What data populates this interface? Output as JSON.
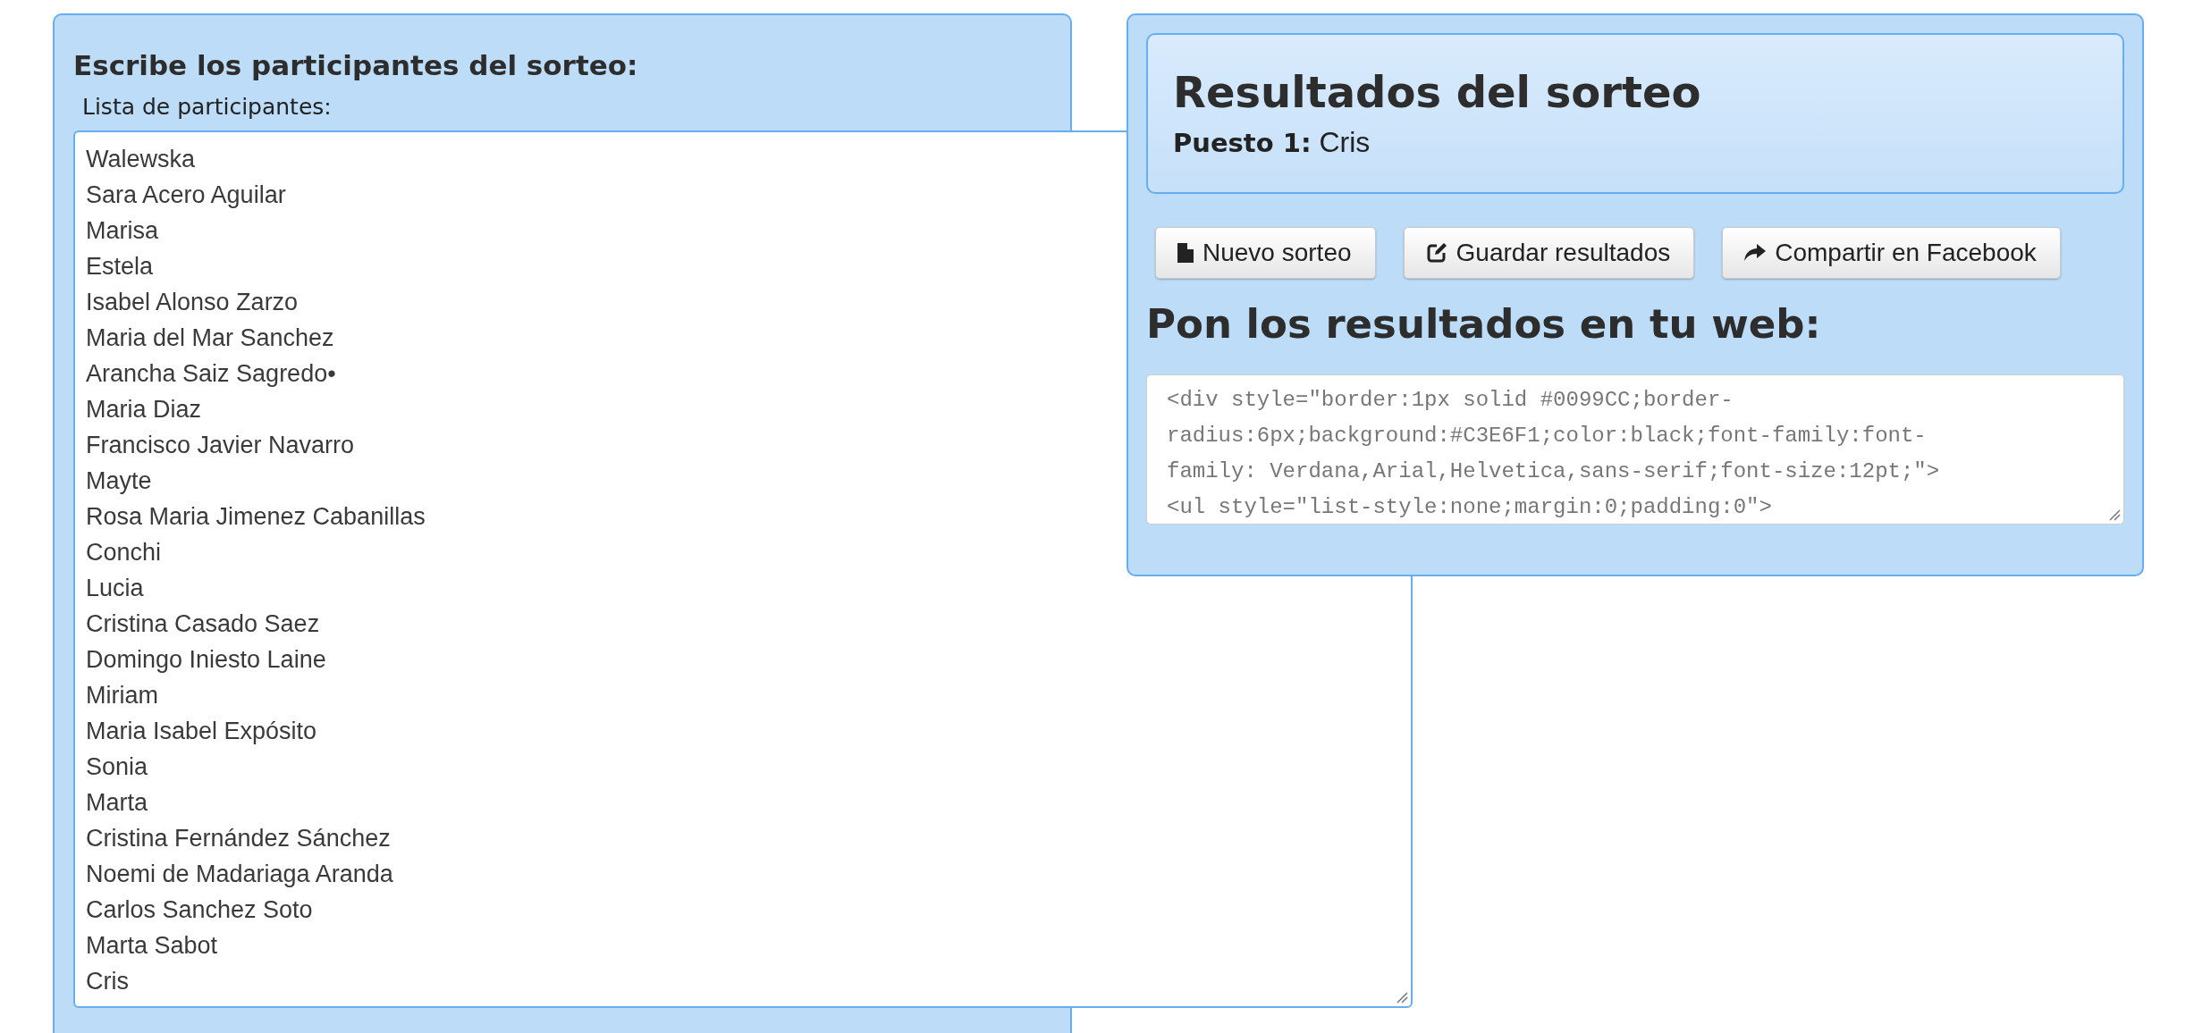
{
  "participants_panel": {
    "title": "Escribe los participantes del sorteo:",
    "label": "Lista de participantes:",
    "participants": [
      "Walewska",
      "Sara Acero Aguilar",
      "Marisa",
      "Estela",
      "Isabel Alonso Zarzo",
      "Maria del Mar Sanchez",
      "Arancha Saiz Sagredo•",
      "Maria Diaz",
      "Francisco Javier Navarro",
      "Mayte",
      "Rosa Maria Jimenez Cabanillas",
      "Conchi",
      "Lucia",
      "Cristina Casado Saez",
      "Domingo Iniesto Laine",
      "Miriam",
      "Maria Isabel Expósito",
      "Sonia",
      "Marta",
      "Cristina Fernández Sánchez",
      "Noemi de Madariaga Aranda",
      "Carlos Sanchez Soto",
      "Marta Sabot",
      "Cris"
    ]
  },
  "results_panel": {
    "title": "Resultados del sorteo",
    "places": [
      {
        "label": "Puesto 1:",
        "name": "Cris"
      }
    ],
    "buttons": [
      {
        "kind": "new",
        "label": "Nuevo sorteo"
      },
      {
        "kind": "save",
        "label": "Guardar resultados"
      },
      {
        "kind": "share",
        "label": "Compartir en Facebook"
      }
    ],
    "embed_title": "Pon los resultados en tu web:",
    "embed_code_lines": [
      "<div style=\"border:1px solid #0099CC;border-",
      "radius:6px;background:#C3E6F1;color:black;font-family:font-",
      "family: Verdana,Arial,Helvetica,sans-serif;font-size:12pt;\">",
      "<ul style=\"list-style:none;margin:0;padding:0\">"
    ]
  }
}
